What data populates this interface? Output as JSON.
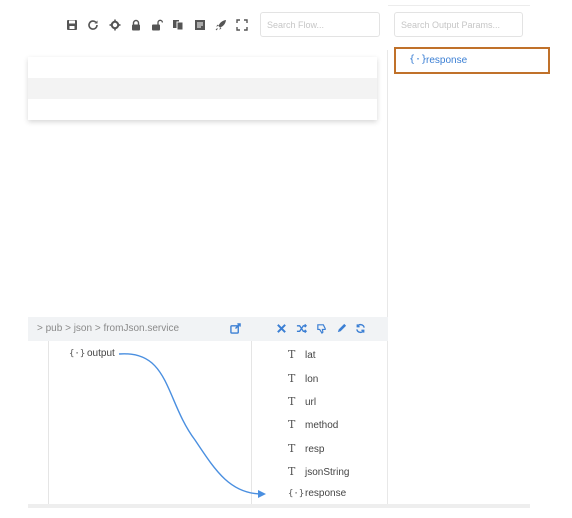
{
  "toolbar": {
    "icons": [
      "save-icon",
      "refresh-icon",
      "settings-icon",
      "lock-icon",
      "unlock-icon",
      "copy-icon",
      "notes-icon",
      "rocket-icon",
      "fullscreen-icon"
    ],
    "search_placeholder": "Search Flow..."
  },
  "output_panel": {
    "search_placeholder": "Search Output Params...",
    "items": [
      {
        "glyph": "{·}",
        "label": "response"
      }
    ]
  },
  "mapping": {
    "breadcrumb": "> pub > json > fromJson.service",
    "header_actions": [
      "open-external-icon",
      "close-icon",
      "shuffle-icon",
      "thumbs-down-icon",
      "edit-icon",
      "sync-icon"
    ],
    "source": {
      "glyph": "{·}",
      "label": "output"
    },
    "targets": [
      {
        "glyph": "T",
        "label": "lat"
      },
      {
        "glyph": "T",
        "label": "lon"
      },
      {
        "glyph": "T",
        "label": "url"
      },
      {
        "glyph": "T",
        "label": "method"
      },
      {
        "glyph": "T",
        "label": "resp"
      },
      {
        "glyph": "T",
        "label": "jsonString"
      },
      {
        "glyph": "{·}",
        "label": "response"
      }
    ]
  },
  "colors": {
    "accent": "#3b7fd4",
    "highlight_border": "#c0712a",
    "icon": "#555555"
  }
}
